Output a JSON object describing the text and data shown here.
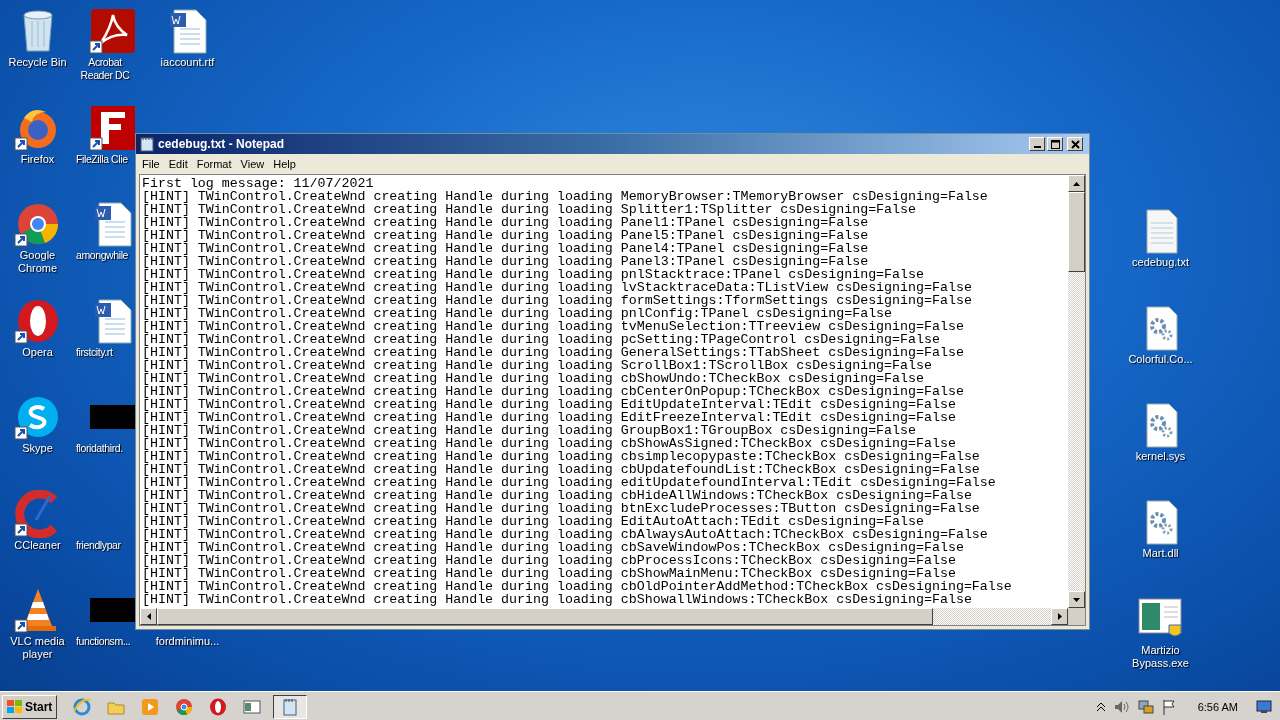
{
  "desktop": {
    "icon_columns": [
      {
        "icons": [
          {
            "label": "Recycle Bin",
            "kind": "recycle"
          },
          {
            "label": "Firefox",
            "kind": "firefox"
          },
          {
            "label": "Google Chrome",
            "kind": "chrome"
          },
          {
            "label": "Opera",
            "kind": "opera"
          },
          {
            "label": "Skype",
            "kind": "skype"
          },
          {
            "label": "CCleaner",
            "kind": "ccleaner"
          },
          {
            "label": "VLC media player",
            "kind": "vlc"
          }
        ]
      },
      {
        "icons": [
          {
            "label": "Acrobat Reader DC",
            "kind": "pdf"
          },
          {
            "label": "FileZilla Clie",
            "kind": "filezilla"
          },
          {
            "label": "amongwhile",
            "kind": "word"
          },
          {
            "label": "firstcity.rt",
            "kind": "word"
          },
          {
            "label": "floridathird.",
            "kind": "redacted"
          },
          {
            "label": "friendlypar",
            "kind": "none"
          },
          {
            "label": "functionsm...",
            "kind": "redacted"
          }
        ]
      },
      {
        "icons": [
          {
            "label": "iaccount.rtf",
            "kind": "word"
          },
          {
            "label": "fordminimu...",
            "kind": "none"
          }
        ]
      }
    ],
    "right_icons": [
      {
        "label": "cedebug.txt",
        "kind": "text"
      },
      {
        "label": "Colorful.Co...",
        "kind": "gearfile"
      },
      {
        "label": "kernel.sys",
        "kind": "gearfile"
      },
      {
        "label": "Mart.dll",
        "kind": "gearfile"
      },
      {
        "label": "Martizio Bypass.exe",
        "kind": "exe"
      }
    ]
  },
  "window": {
    "title": "cedebug.txt - Notepad",
    "menu": [
      "File",
      "Edit",
      "Format",
      "View",
      "Help"
    ],
    "lines": [
      "First log message: 11/07/2021",
      "[HINT] TWinControl.CreateWnd creating Handle during loading MemoryBrowser:TMemoryBrowser csDesigning=False",
      "[HINT] TWinControl.CreateWnd creating Handle during loading Splitter1:TSplitter csDesigning=False",
      "[HINT] TWinControl.CreateWnd creating Handle during loading Panel1:TPanel csDesigning=False",
      "[HINT] TWinControl.CreateWnd creating Handle during loading Panel5:TPanel csDesigning=False",
      "[HINT] TWinControl.CreateWnd creating Handle during loading Panel4:TPanel csDesigning=False",
      "[HINT] TWinControl.CreateWnd creating Handle during loading Panel3:TPanel csDesigning=False",
      "[HINT] TWinControl.CreateWnd creating Handle during loading pnlStacktrace:TPanel csDesigning=False",
      "[HINT] TWinControl.CreateWnd creating Handle during loading lvStacktraceData:TListView csDesigning=False",
      "[HINT] TWinControl.CreateWnd creating Handle during loading formSettings:TformSettings csDesigning=False",
      "[HINT] TWinControl.CreateWnd creating Handle during loading pnlConfig:TPanel csDesigning=False",
      "[HINT] TWinControl.CreateWnd creating Handle during loading tvMenuSelection:TTreeview csDesigning=False",
      "[HINT] TWinControl.CreateWnd creating Handle during loading pcSetting:TPageControl csDesigning=False",
      "[HINT] TWinControl.CreateWnd creating Handle during loading GeneralSettings:TTabSheet csDesigning=False",
      "[HINT] TWinControl.CreateWnd creating Handle during loading ScrollBox1:TScrollBox csDesigning=False",
      "[HINT] TWinControl.CreateWnd creating Handle during loading cbShowUndo:TCheckBox csDesigning=False",
      "[HINT] TWinControl.CreateWnd creating Handle during loading cbCenterOnPopup:TCheckBox csDesigning=False",
      "[HINT] TWinControl.CreateWnd creating Handle during loading EditUpdateInterval:TEdit csDesigning=False",
      "[HINT] TWinControl.CreateWnd creating Handle during loading EditFreezeInterval:TEdit csDesigning=False",
      "[HINT] TWinControl.CreateWnd creating Handle during loading GroupBox1:TGroupBox csDesigning=False",
      "[HINT] TWinControl.CreateWnd creating Handle during loading cbShowAsSigned:TCheckBox csDesigning=False",
      "[HINT] TWinControl.CreateWnd creating Handle during loading cbsimplecopypaste:TCheckBox csDesigning=False",
      "[HINT] TWinControl.CreateWnd creating Handle during loading cbUpdatefoundList:TCheckBox csDesigning=False",
      "[HINT] TWinControl.CreateWnd creating Handle during loading editUpdatefoundInterval:TEdit csDesigning=False",
      "[HINT] TWinControl.CreateWnd creating Handle during loading cbHideAllWindows:TCheckBox csDesigning=False",
      "[HINT] TWinControl.CreateWnd creating Handle during loading btnExcludeProcesses:TButton csDesigning=False",
      "[HINT] TWinControl.CreateWnd creating Handle during loading EditAutoAttach:TEdit csDesigning=False",
      "[HINT] TWinControl.CreateWnd creating Handle during loading cbAlwaysAutoAttach:TCheckBox csDesigning=False",
      "[HINT] TWinControl.CreateWnd creating Handle during loading cbSaveWindowPos:TCheckBox csDesigning=False",
      "[HINT] TWinControl.CreateWnd creating Handle during loading cbProcessIcons:TCheckBox csDesigning=False",
      "[HINT] TWinControl.CreateWnd creating Handle during loading cbShowMainMenu:TCheckBox csDesigning=False",
      "[HINT] TWinControl.CreateWnd creating Handle during loading cbOldPointerAddMethod:TCheckBox csDesigning=False",
      "[HINT] TWinControl.CreateWnd creating Handle during loading cbShowallWindows:TCheckBox csDesigning=False"
    ]
  },
  "taskbar": {
    "start": "Start",
    "apps": [
      {
        "kind": "ie",
        "selected": false
      },
      {
        "kind": "folder",
        "selected": false
      },
      {
        "kind": "media",
        "selected": false
      },
      {
        "kind": "chrome",
        "selected": false
      },
      {
        "kind": "opera",
        "selected": false
      },
      {
        "kind": "window",
        "selected": false
      },
      {
        "kind": "notepad",
        "selected": true
      }
    ],
    "clock": "6:56 AM"
  }
}
